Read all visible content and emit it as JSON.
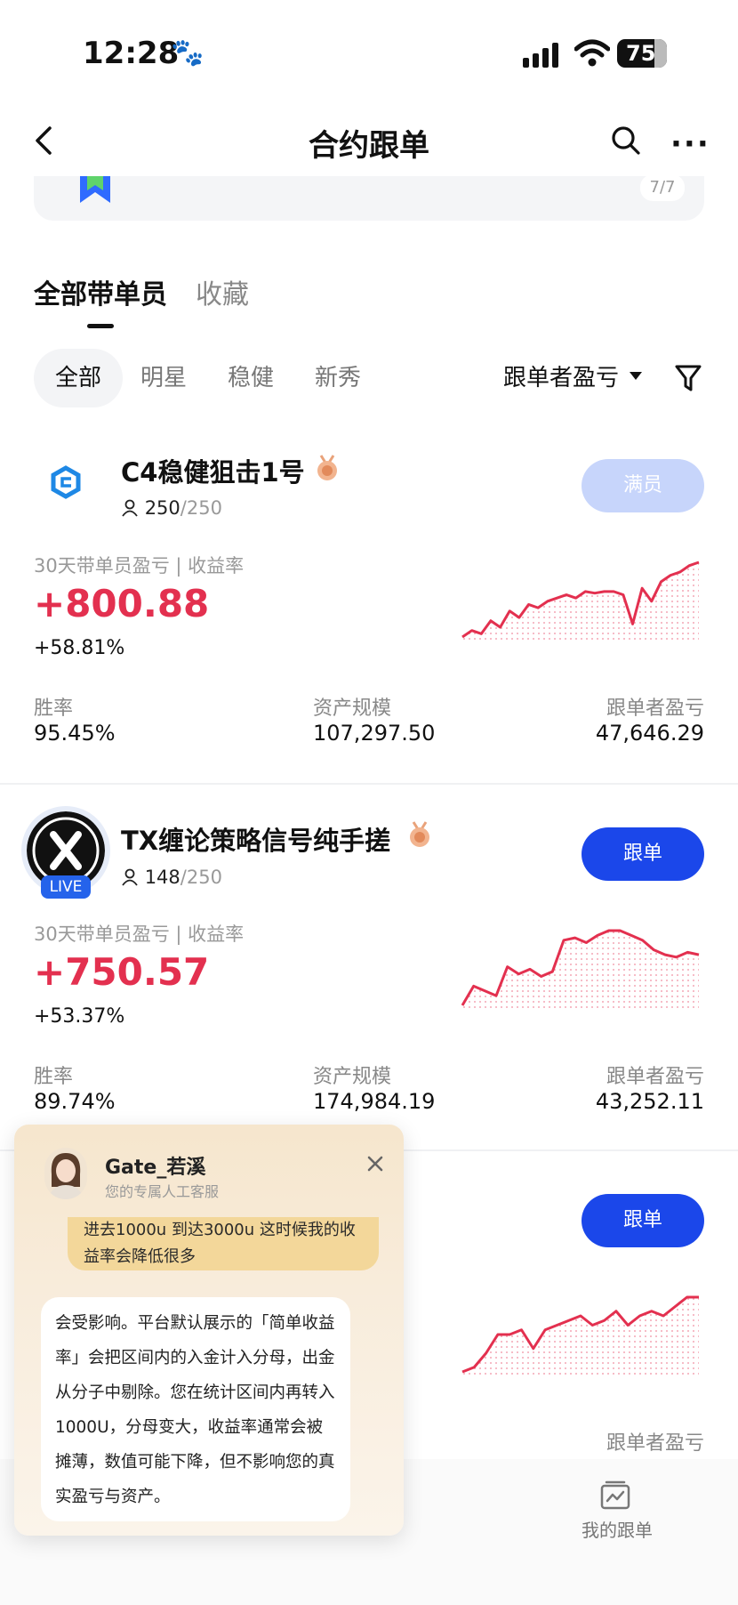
{
  "status_bar": {
    "time": "12:28",
    "battery": "75"
  },
  "nav": {
    "title": "合约跟单"
  },
  "banner": {
    "page_indicator": "7/7"
  },
  "tabs": [
    {
      "label": "全部带单员",
      "active": true
    },
    {
      "label": "收藏",
      "active": false
    }
  ],
  "filters": {
    "chips": [
      "全部",
      "明星",
      "稳健",
      "新秀"
    ],
    "sort_label": "跟单者盈亏"
  },
  "cards": [
    {
      "name": "C4稳健狙击1号",
      "members": "250",
      "members_total": "/250",
      "button": "满员",
      "subtitle": "30天带单员盈亏 | 收益率",
      "pnl": "+800.88",
      "rate": "+58.81%",
      "stats": [
        {
          "label": "胜率",
          "value": "95.45%"
        },
        {
          "label": "资产规模",
          "value": "107,297.50"
        },
        {
          "label": "跟单者盈亏",
          "value": "47,646.29"
        }
      ],
      "trend": [
        10,
        14,
        12,
        20,
        16,
        26,
        22,
        30,
        28,
        32,
        34,
        36,
        34,
        38,
        37,
        38,
        38,
        36,
        18,
        40,
        32,
        44,
        48,
        50,
        54,
        56
      ]
    },
    {
      "name": "TX缠论策略信号纯手搓",
      "live_badge": "LIVE",
      "members": "148",
      "members_total": "/250",
      "button": "跟单",
      "subtitle": "30天带单员盈亏 | 收益率",
      "pnl": "+750.57",
      "rate": "+53.37%",
      "stats": [
        {
          "label": "胜率",
          "value": "89.74%"
        },
        {
          "label": "资产规模",
          "value": "174,984.19"
        },
        {
          "label": "跟单者盈亏",
          "value": "43,252.11"
        }
      ],
      "trend": [
        4,
        20,
        16,
        12,
        36,
        30,
        34,
        28,
        32,
        58,
        60,
        56,
        62,
        66,
        66,
        62,
        58,
        50,
        46,
        44,
        48,
        46
      ]
    },
    {
      "button": "跟单",
      "stats": [
        {
          "label": "跟单者盈亏"
        }
      ],
      "trend": [
        10,
        12,
        18,
        26,
        26,
        28,
        20,
        28,
        30,
        32,
        34,
        30,
        32,
        36,
        30,
        34,
        36,
        34,
        38,
        42,
        42
      ]
    }
  ],
  "bottom": {
    "my_trades": "我的跟单"
  },
  "chat": {
    "agent_name": "Gate_若溪",
    "agent_role": "您的专属人工客服",
    "user_message": "进去1000u 到达3000u 这时候我的收益率会降低很多",
    "agent_message": "会受影响。平台默认展示的「简单收益率」会把区间内的入金计入分母，出金从分子中剔除。您在统计区间内再转入1000U，分母变大，收益率通常会被摊薄，数值可能下降，但不影响您的真实盈亏与资产。"
  },
  "colors": {
    "accent": "#1b47ea",
    "profit": "#e3304f",
    "button_disabled": "#c7d5fb"
  }
}
